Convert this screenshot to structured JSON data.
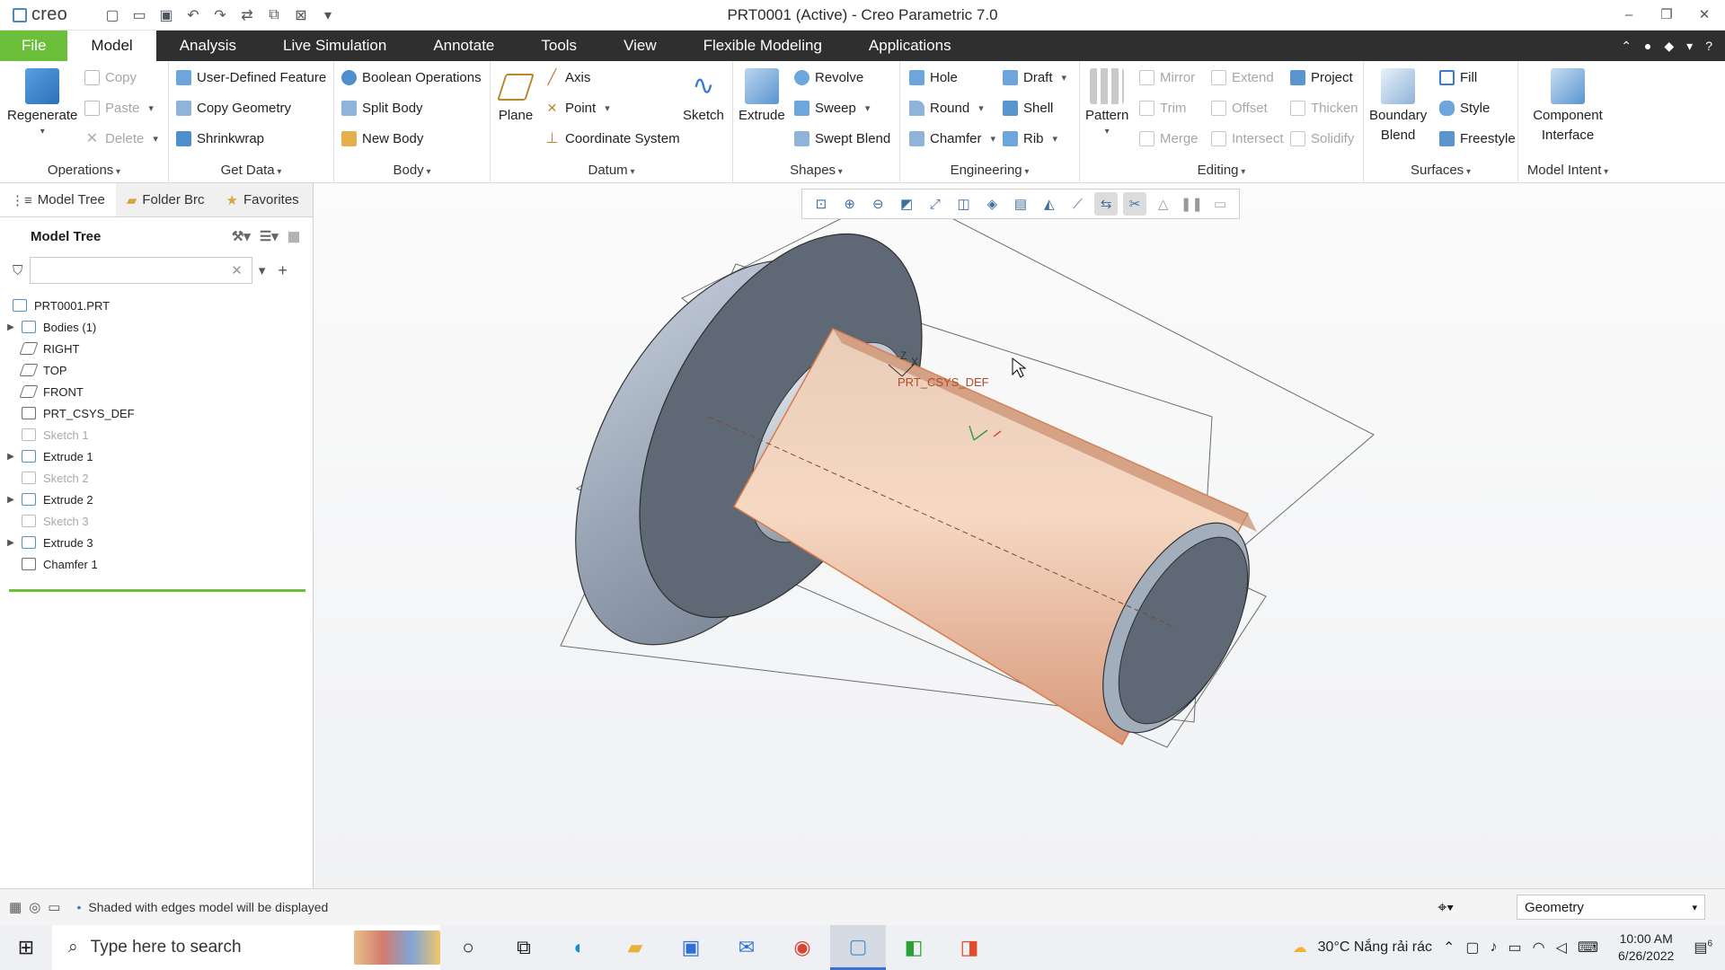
{
  "app": {
    "logo_text": "creo",
    "window_title": "PRT0001 (Active) - Creo Parametric 7.0"
  },
  "tabs": {
    "file": "File",
    "items": [
      "Model",
      "Analysis",
      "Live Simulation",
      "Annotate",
      "Tools",
      "View",
      "Flexible Modeling",
      "Applications"
    ]
  },
  "ribbon": {
    "operations": {
      "label": "Operations",
      "regenerate": "Regenerate",
      "copy": "Copy",
      "paste": "Paste",
      "delete": "Delete"
    },
    "get_data": {
      "label": "Get Data",
      "user_defined_feature": "User-Defined Feature",
      "copy_geometry": "Copy Geometry",
      "shrinkwrap": "Shrinkwrap"
    },
    "body": {
      "label": "Body",
      "boolean_operations": "Boolean Operations",
      "split_body": "Split Body",
      "new_body": "New Body"
    },
    "datum": {
      "label": "Datum",
      "plane": "Plane",
      "axis": "Axis",
      "point": "Point",
      "coordinate_system": "Coordinate System",
      "sketch": "Sketch"
    },
    "shapes": {
      "label": "Shapes",
      "extrude": "Extrude",
      "revolve": "Revolve",
      "sweep": "Sweep",
      "swept_blend": "Swept Blend"
    },
    "engineering": {
      "label": "Engineering",
      "hole": "Hole",
      "round": "Round",
      "chamfer": "Chamfer",
      "draft": "Draft",
      "shell": "Shell",
      "rib": "Rib"
    },
    "editing": {
      "label": "Editing",
      "pattern": "Pattern",
      "mirror": "Mirror",
      "trim": "Trim",
      "merge": "Merge",
      "extend": "Extend",
      "offset": "Offset",
      "intersect": "Intersect",
      "project": "Project",
      "thicken": "Thicken",
      "solidify": "Solidify"
    },
    "surfaces": {
      "label": "Surfaces",
      "boundary": "Boundary",
      "blend": "Blend",
      "fill": "Fill",
      "style": "Style",
      "freestyle": "Freestyle"
    },
    "model_intent": {
      "label": "Model Intent",
      "component": "Component",
      "interface": "Interface"
    }
  },
  "panel": {
    "tabs": [
      "Model Tree",
      "Folder Brc",
      "Favorites"
    ],
    "heading": "Model Tree",
    "filter_value": "",
    "tree": [
      {
        "label": "PRT0001.PRT",
        "expandable": false,
        "dim": false,
        "icon": "part-icon",
        "color": "#4f8fd0"
      },
      {
        "label": "Bodies (1)",
        "expandable": true,
        "dim": false,
        "icon": "bodies-icon",
        "color": "#4f8fd0"
      },
      {
        "label": "RIGHT",
        "expandable": false,
        "dim": false,
        "icon": "datum-plane-icon",
        "color": "#6c6c6c"
      },
      {
        "label": "TOP",
        "expandable": false,
        "dim": false,
        "icon": "datum-plane-icon",
        "color": "#6c6c6c"
      },
      {
        "label": "FRONT",
        "expandable": false,
        "dim": false,
        "icon": "datum-plane-icon",
        "color": "#6c6c6c"
      },
      {
        "label": "PRT_CSYS_DEF",
        "expandable": false,
        "dim": false,
        "icon": "csys-icon",
        "color": "#6c6c6c"
      },
      {
        "label": "Sketch 1",
        "expandable": false,
        "dim": true,
        "icon": "sketch-icon",
        "color": "#b9b9b9"
      },
      {
        "label": "Extrude 1",
        "expandable": true,
        "dim": false,
        "icon": "extrude-icon",
        "color": "#4f8fd0"
      },
      {
        "label": "Sketch 2",
        "expandable": false,
        "dim": true,
        "icon": "sketch-icon",
        "color": "#b9b9b9"
      },
      {
        "label": "Extrude 2",
        "expandable": true,
        "dim": false,
        "icon": "extrude-icon",
        "color": "#4f8fd0"
      },
      {
        "label": "Sketch 3",
        "expandable": false,
        "dim": true,
        "icon": "sketch-icon",
        "color": "#b9b9b9"
      },
      {
        "label": "Extrude 3",
        "expandable": true,
        "dim": false,
        "icon": "extrude-icon",
        "color": "#4f8fd0"
      },
      {
        "label": "Chamfer 1",
        "expandable": false,
        "dim": false,
        "icon": "chamfer-icon",
        "color": "#6c6c6c"
      }
    ]
  },
  "viewport": {
    "csys_label": "PRT_CSYS_DEF",
    "axis_z": "Z",
    "axis_x": "X",
    "colors": {
      "body": "#9aa6b6",
      "face_dark": "#5d6775",
      "selection": "#e8a57f"
    }
  },
  "status": {
    "message": "Shaded with edges model will be displayed",
    "filter_value": "Geometry"
  },
  "taskbar": {
    "search_placeholder": "Type here to search",
    "weather": "30°C  Nắng rải rác",
    "time": "10:00 AM",
    "date": "6/26/2022",
    "notification_count": "6"
  }
}
